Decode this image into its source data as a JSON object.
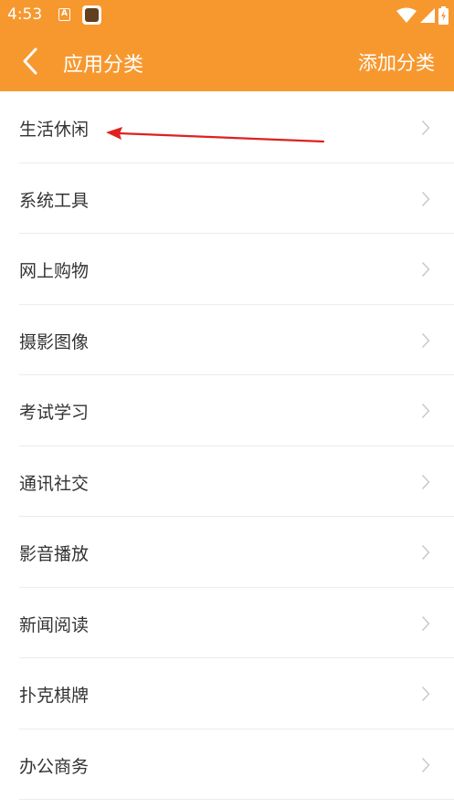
{
  "status_bar": {
    "time": "4:53",
    "notification_a_glyph": "A",
    "icons": [
      "notification-a-icon",
      "app-notification-icon",
      "wifi-icon",
      "signal-icon",
      "battery-icon"
    ]
  },
  "app_bar": {
    "title": "应用分类",
    "action_label": "添加分类",
    "background_color": "#f7982f",
    "text_color": "#ffffff"
  },
  "categories": [
    {
      "label": "生活休闲"
    },
    {
      "label": "系统工具"
    },
    {
      "label": "网上购物"
    },
    {
      "label": "摄影图像"
    },
    {
      "label": "考试学习"
    },
    {
      "label": "通讯社交"
    },
    {
      "label": "影音播放"
    },
    {
      "label": "新闻阅读"
    },
    {
      "label": "扑克棋牌"
    },
    {
      "label": "办公商务"
    }
  ],
  "annotation": {
    "type": "red-arrow",
    "points_to": "生活休闲",
    "color": "#e02020"
  }
}
